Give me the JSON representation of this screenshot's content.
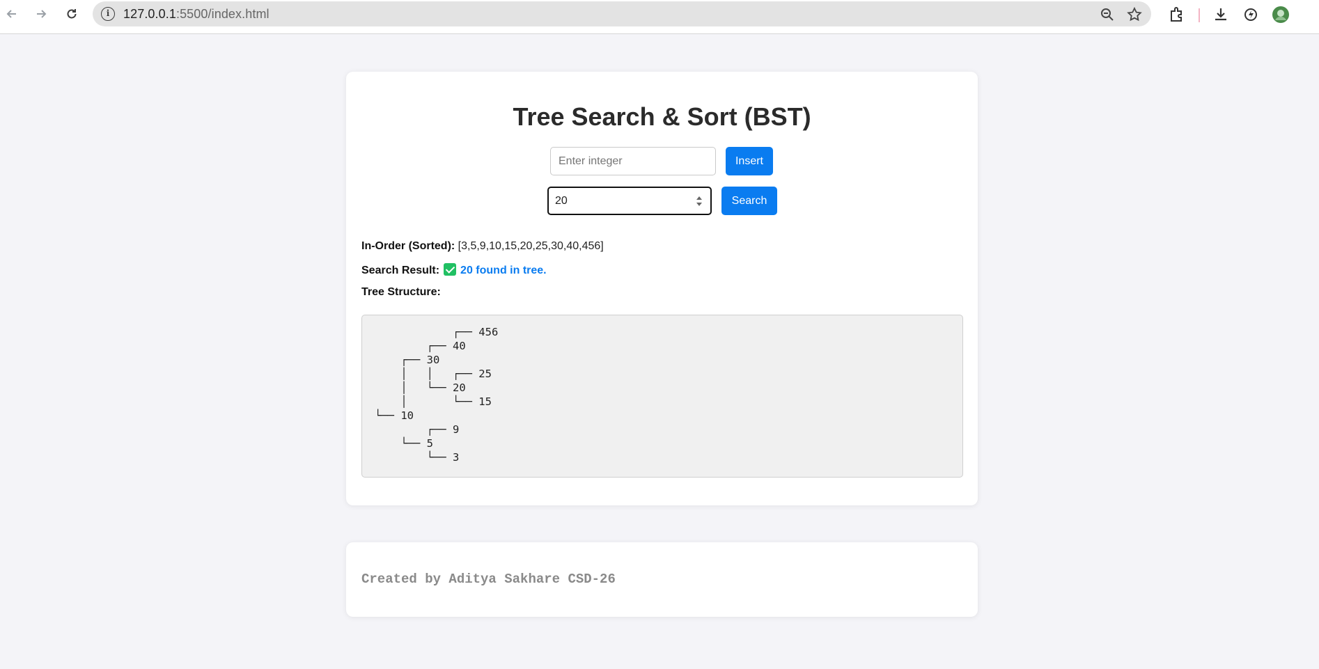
{
  "browser": {
    "url_host": "127.0.0.1",
    "url_port": ":5500",
    "url_path": "/index.html"
  },
  "app": {
    "title": "Tree Search & Sort (BST)",
    "insert_placeholder": "Enter integer",
    "insert_label": "Insert",
    "search_value": "20",
    "search_label": "Search"
  },
  "results": {
    "inorder_label": "In-Order (Sorted):",
    "inorder_value": "[3,5,9,10,15,20,25,30,40,456]",
    "search_label": "Search Result:",
    "search_value": "20 found in tree.",
    "tree_label": "Tree Structure:"
  },
  "tree": [
    "            ┌── 456",
    "        ┌── 40",
    "    ┌── 30",
    "    │   │   ┌── 25",
    "    │   └── 20",
    "    │       └── 15",
    "└── 10",
    "        ┌── 9",
    "    └── 5",
    "        └── 3"
  ],
  "footer": {
    "credit": "Created by Aditya Sakhare CSD-26"
  },
  "colors": {
    "accent": "#0a7cf0",
    "success": "#21c063",
    "page_bg": "#f4f4f8"
  }
}
